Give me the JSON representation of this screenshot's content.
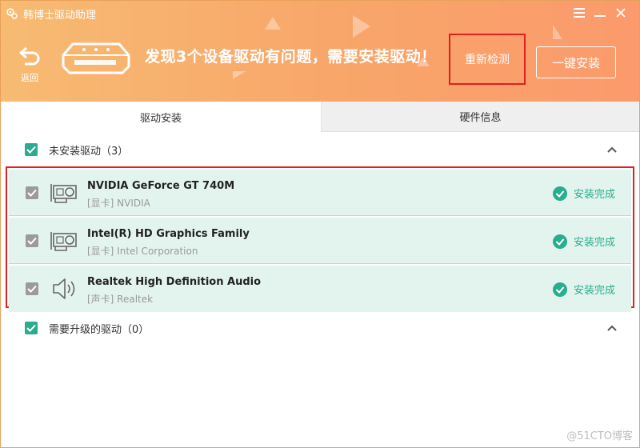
{
  "app": {
    "title": "韩博士驱动助理",
    "icon": "gear-icon"
  },
  "window_controls": [
    {
      "name": "menu-button",
      "icon": "menu-icon"
    },
    {
      "name": "minimize-button",
      "icon": "minimize-icon"
    },
    {
      "name": "close-button",
      "icon": "close-icon"
    }
  ],
  "header": {
    "back_label": "返回",
    "headline": "发现3个设备驱动有问题，需要安装驱动！",
    "rescan_label": "重新检测",
    "install_label": "一键安装"
  },
  "tabs": [
    {
      "label": "驱动安装",
      "active": true
    },
    {
      "label": "硬件信息",
      "active": false
    }
  ],
  "sections": {
    "not_installed": {
      "label": "未安装驱动（3）",
      "checked": true
    },
    "need_upgrade": {
      "label": "需要升级的驱动（0）",
      "checked": true
    }
  },
  "drivers": [
    {
      "name": "NVIDIA GeForce GT 740M",
      "sub": "[显卡] NVIDIA",
      "icon": "graphics-card-icon",
      "status": "安装完成",
      "checked": true
    },
    {
      "name": "Intel(R) HD Graphics Family",
      "sub": "[显卡] Intel Corporation",
      "icon": "graphics-card-icon",
      "status": "安装完成",
      "checked": true
    },
    {
      "name": "Realtek High Definition Audio",
      "sub": "[声卡] Realtek",
      "icon": "speaker-icon",
      "status": "安装完成",
      "checked": true
    }
  ],
  "watermark": "@51CTO博客",
  "colors": {
    "accent": "#2aac8f",
    "header_start": "#f7bb72",
    "header_end": "#fb9a6c",
    "highlight": "#e02020"
  }
}
